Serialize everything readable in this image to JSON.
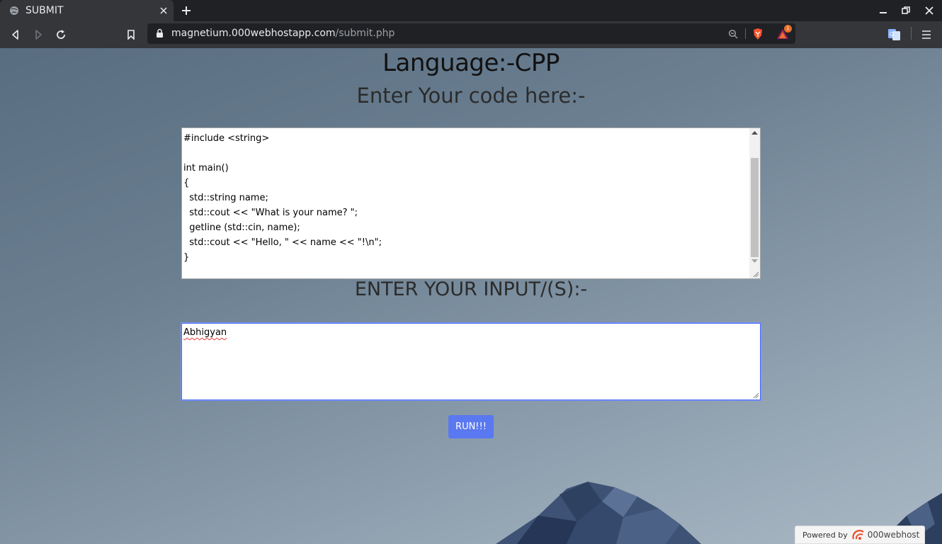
{
  "browser": {
    "tab_title": "SUBMIT",
    "url_host": "magnetium.000webhostapp.com",
    "url_path": "/submit.php",
    "brave_badge": "1"
  },
  "page": {
    "language_title": "Language:-CPP",
    "code_label": "Enter Your code here:-",
    "code_text": "#include <string>\n\nint main()\n{\n  std::string name;\n  std::cout << \"What is your name? \";\n  getline (std::cin, name);\n  std::cout << \"Hello, \" << name << \"!\\n\";\n}",
    "input_label": "ENTER YOUR INPUT/(S):-",
    "input_value": "Abhigyan",
    "run_label": "RUN!!!"
  },
  "footer": {
    "powered_by": "Powered by",
    "brand": "000webhost"
  },
  "colors": {
    "accent": "#5a78f0",
    "chrome_bg": "#35363a",
    "tab_bg": "#202124"
  }
}
